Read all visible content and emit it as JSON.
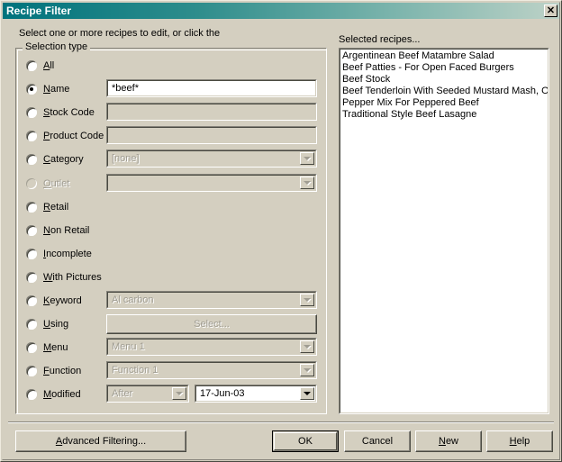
{
  "window": {
    "title": "Recipe Filter",
    "close_label": "✕",
    "hint": "Select one or more recipes to edit, or click the"
  },
  "group": {
    "title": "Selection type",
    "rows": [
      {
        "name": "all",
        "label": "A",
        "label_rest": "ll",
        "checked": false,
        "disabled": false,
        "control": null
      },
      {
        "name": "name",
        "label": "N",
        "label_rest": "ame",
        "checked": true,
        "disabled": false,
        "control": {
          "kind": "textbox",
          "value": "*beef*",
          "disabled": false
        }
      },
      {
        "name": "stock-code",
        "label": "S",
        "label_rest": "tock Code",
        "checked": false,
        "disabled": false,
        "control": {
          "kind": "textbox",
          "value": "",
          "disabled": true
        }
      },
      {
        "name": "product-code",
        "label": "P",
        "label_rest": "roduct Code",
        "checked": false,
        "disabled": false,
        "control": {
          "kind": "textbox",
          "value": "",
          "disabled": true
        }
      },
      {
        "name": "category",
        "label": "C",
        "label_rest": "ategory",
        "checked": false,
        "disabled": false,
        "control": {
          "kind": "combo",
          "value": "[none]",
          "disabled": true
        }
      },
      {
        "name": "outlet",
        "label": "O",
        "label_rest": "utlet",
        "checked": false,
        "disabled": true,
        "control": {
          "kind": "combo",
          "value": "",
          "disabled": true
        }
      },
      {
        "name": "retail",
        "label": "R",
        "label_rest": "etail",
        "checked": false,
        "disabled": false,
        "control": null
      },
      {
        "name": "non-retail",
        "label": "N",
        "label_rest": "on Retail",
        "checked": false,
        "disabled": false,
        "control": null
      },
      {
        "name": "incomplete",
        "label": "I",
        "label_rest": "ncomplete",
        "checked": false,
        "disabled": false,
        "control": null
      },
      {
        "name": "with-pictures",
        "label": "W",
        "label_rest": "ith Pictures",
        "checked": false,
        "disabled": false,
        "control": null
      },
      {
        "name": "keyword",
        "label": "K",
        "label_rest": "eyword",
        "checked": false,
        "disabled": false,
        "control": {
          "kind": "combo",
          "value": "Al carbon",
          "disabled": true
        }
      },
      {
        "name": "using",
        "label": "U",
        "label_rest": "sing",
        "checked": false,
        "disabled": false,
        "control": {
          "kind": "button",
          "value": "Select...",
          "disabled": true
        }
      },
      {
        "name": "menu",
        "label": "M",
        "label_rest": "enu",
        "checked": false,
        "disabled": false,
        "control": {
          "kind": "combo",
          "value": "Menu 1",
          "disabled": true
        }
      },
      {
        "name": "function",
        "label": "F",
        "label_rest": "unction",
        "checked": false,
        "disabled": false,
        "control": {
          "kind": "combo",
          "value": "Function 1",
          "disabled": true
        }
      },
      {
        "name": "modified",
        "label": "M",
        "label_rest": "odified",
        "checked": false,
        "disabled": false,
        "control": {
          "kind": "dual",
          "value": "After",
          "disabled": true,
          "second_value": "17-Jun-03",
          "second_disabled": false
        }
      }
    ]
  },
  "recipes": {
    "label": "Selected recipes...",
    "items": [
      "Argentinean Beef Matambre Salad",
      "Beef Patties - For Open Faced Burgers",
      "Beef Stock",
      "Beef Tenderloin With Seeded Mustard Mash, Oy",
      "Pepper Mix For Peppered Beef",
      "Traditional Style Beef Lasagne"
    ]
  },
  "buttons": {
    "advanced": {
      "pre": "A",
      "key": "",
      "rest": "dvanced Filtering..."
    },
    "ok": "OK",
    "cancel": "Cancel",
    "new": {
      "key": "N",
      "rest": "ew"
    },
    "help": {
      "key": "H",
      "rest": "elp"
    }
  },
  "colors": {
    "face": "#d4cfc0",
    "title_start": "#00737d",
    "title_end": "#bdd2c7",
    "disabled_text": "#a09d92"
  }
}
